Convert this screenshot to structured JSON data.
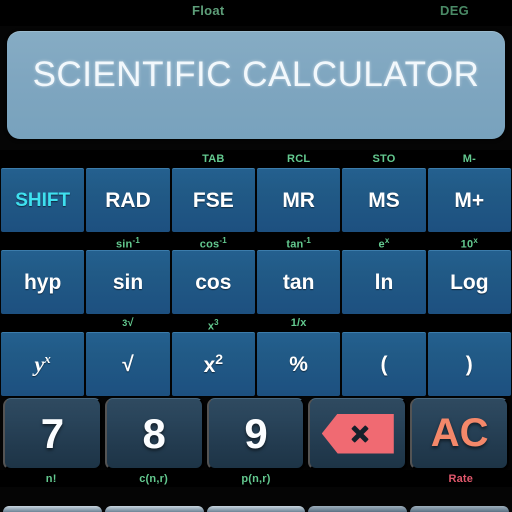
{
  "statusbar": {
    "mode_format": "Float",
    "angle_unit": "DEG"
  },
  "display": {
    "title": "SCIENTIFIC CALCULATOR"
  },
  "colors": {
    "display_bg": "#7fa6c0",
    "button_blue": "#1d5080",
    "shift_cyan": "#3fe0ef",
    "alt_green": "#63c98f",
    "alt_red": "#e0576b",
    "accent_salmon": "#f4886a",
    "backspace_red": "#f06a72",
    "number_button": "#29445a",
    "background": "#000000"
  },
  "keypad": {
    "rows": [
      {
        "alt_labels": [
          {
            "text": "",
            "pos": 0
          },
          {
            "text": "",
            "pos": 1
          },
          {
            "text": "TAB",
            "pos": 2
          },
          {
            "text": "RCL",
            "pos": 3
          },
          {
            "text": "STO",
            "pos": 4
          },
          {
            "text": "M-",
            "pos": 5
          }
        ],
        "keys": [
          {
            "label": "SHIFT",
            "style": "shift"
          },
          {
            "label": "RAD",
            "style": "normal"
          },
          {
            "label": "FSE",
            "style": "normal"
          },
          {
            "label": "MR",
            "style": "normal"
          },
          {
            "label": "MS",
            "style": "normal"
          },
          {
            "label": "M+",
            "style": "normal"
          }
        ]
      },
      {
        "alt_labels": [
          {
            "text": "",
            "pos": 0
          },
          {
            "text": "sin-1",
            "pos": 1
          },
          {
            "text": "cos-1",
            "pos": 2
          },
          {
            "text": "tan-1",
            "pos": 3
          },
          {
            "text": "ex",
            "pos": 4
          },
          {
            "text": "10x",
            "pos": 5
          }
        ],
        "keys": [
          {
            "label": "hyp",
            "style": "normal"
          },
          {
            "label": "sin",
            "style": "normal"
          },
          {
            "label": "cos",
            "style": "normal"
          },
          {
            "label": "tan",
            "style": "normal"
          },
          {
            "label": "ln",
            "style": "normal"
          },
          {
            "label": "Log",
            "style": "normal"
          }
        ]
      },
      {
        "alt_labels": [
          {
            "text": "",
            "pos": 0
          },
          {
            "text": "3root",
            "pos": 1
          },
          {
            "text": "x3",
            "pos": 2
          },
          {
            "text": "1/x",
            "pos": 3
          },
          {
            "text": "",
            "pos": 4
          },
          {
            "text": "",
            "pos": 5
          }
        ],
        "keys": [
          {
            "label": "y^x",
            "style": "power"
          },
          {
            "label": "√",
            "style": "normal"
          },
          {
            "label": "x2",
            "style": "square"
          },
          {
            "label": "%",
            "style": "normal"
          },
          {
            "label": "(",
            "style": "normal"
          },
          {
            "label": ")",
            "style": "normal"
          }
        ]
      }
    ],
    "number_row": {
      "keys": [
        {
          "label": "7",
          "type": "digit"
        },
        {
          "label": "8",
          "type": "digit"
        },
        {
          "label": "9",
          "type": "digit"
        },
        {
          "label": "",
          "type": "backspace"
        },
        {
          "label": "AC",
          "type": "clear"
        }
      ],
      "alt_labels": [
        {
          "text": "n!",
          "color": "green"
        },
        {
          "text": "c(n,r)",
          "color": "green"
        },
        {
          "text": "p(n,r)",
          "color": "green"
        },
        {
          "text": "",
          "color": "green"
        },
        {
          "text": "Rate",
          "color": "red"
        }
      ]
    }
  },
  "alt_sub": {
    "sin_inv": {
      "base": "sin",
      "sup": "-1"
    },
    "cos_inv": {
      "base": "cos",
      "sup": "-1"
    },
    "tan_inv": {
      "base": "tan",
      "sup": "-1"
    },
    "e_pow": {
      "base": "e",
      "sup": "x"
    },
    "ten_pow": {
      "base": "10",
      "sup": "x"
    },
    "cube_root": {
      "base": "√",
      "pre": "3"
    },
    "x_cube": {
      "base": "x",
      "sup": "3"
    },
    "recip": {
      "base": "1/x",
      "sup": ""
    }
  },
  "key_glyphs": {
    "y_base": "y",
    "y_sup": "x",
    "x_base": "x",
    "x_sup": "2",
    "sqrt": "√"
  }
}
